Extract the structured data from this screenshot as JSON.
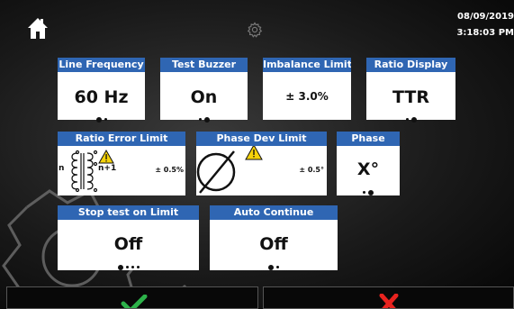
{
  "header": {
    "date": "08/09/2019",
    "time": "3:18:03 PM",
    "home_icon": "home-icon",
    "settings_icon": "gear-icon"
  },
  "settings": {
    "line_frequency": {
      "label": "Line Frequency",
      "value": "60 Hz",
      "option_count": 2,
      "selected_index": 0
    },
    "test_buzzer": {
      "label": "Test Buzzer",
      "value": "On",
      "option_count": 2,
      "selected_index": 1
    },
    "imbalance_limit": {
      "label": "Imbalance Limit",
      "value": "± 3.0%"
    },
    "ratio_display": {
      "label": "Ratio Display",
      "value": "TTR",
      "option_count": 2,
      "selected_index": 1
    },
    "ratio_error_limit": {
      "label": "Ratio Error Limit",
      "value": "± 0.5%",
      "n_label": "n",
      "n1_label": "n+1"
    },
    "phase_dev_limit": {
      "label": "Phase Dev Limit",
      "value": "± 0.5°"
    },
    "phase": {
      "label": "Phase",
      "value": "X°",
      "option_count": 2,
      "selected_index": 1
    },
    "stop_test_on_limit": {
      "label": "Stop test on Limit",
      "value": "Off",
      "option_count": 4,
      "selected_index": 0
    },
    "auto_continue": {
      "label": "Auto Continue",
      "value": "Off",
      "option_count": 2,
      "selected_index": 0
    }
  },
  "footer": {
    "accept_icon": "checkmark-icon",
    "cancel_icon": "x-icon",
    "accept_color": "#2db24a",
    "cancel_color": "#e8231f"
  },
  "colors": {
    "header_blue": "#2f66b3",
    "warning_yellow": "#f5d20a"
  }
}
